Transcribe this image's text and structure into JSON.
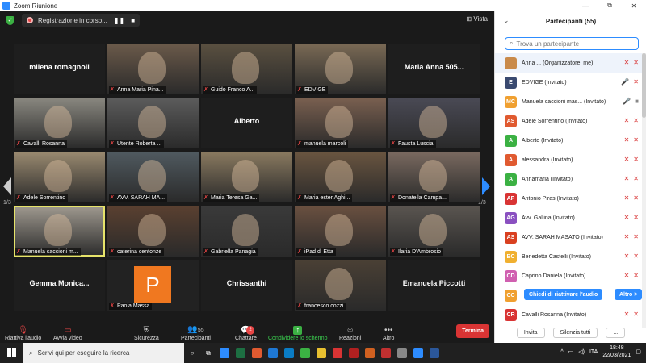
{
  "window": {
    "title": "Zoom Riunione",
    "min_glyph": "—",
    "max_glyph": "⧉",
    "close_glyph": "✕"
  },
  "topbar": {
    "recording_text": "Registrazione in corso...",
    "pause_glyph": "❚❚",
    "stop_glyph": "■",
    "view_label": "Vista",
    "view_glyph": "⊞",
    "shield_glyph": "✓"
  },
  "pages": {
    "left": "1/3",
    "right": "1/3"
  },
  "tiles": [
    {
      "name": "milena romagnoli",
      "type": "black"
    },
    {
      "name": "Anna Maria Pina...",
      "type": "video",
      "bg": "#6b5a4a"
    },
    {
      "name": "Guido Franco A...",
      "type": "video",
      "bg": "#5a5040"
    },
    {
      "name": "EDVIGE",
      "type": "video",
      "bg": "#7a6a55"
    },
    {
      "name": "Maria Anna 505...",
      "type": "black"
    },
    {
      "name": "Cavalli Rosanna",
      "type": "video",
      "bg": "#8a8880"
    },
    {
      "name": "Utente Roberta ...",
      "type": "video",
      "bg": "#5c5c5c"
    },
    {
      "name": "Alberto",
      "type": "black"
    },
    {
      "name": "manuela marcoli",
      "type": "video",
      "bg": "#7a6050"
    },
    {
      "name": "Fausta Luscia",
      "type": "video",
      "bg": "#4a4a55"
    },
    {
      "name": "Adele Sorrentino",
      "type": "video",
      "bg": "#9a8a70"
    },
    {
      "name": "AVV. SARAH MA...",
      "type": "video",
      "bg": "#505a60"
    },
    {
      "name": "Maria Teresa Ga...",
      "type": "video",
      "bg": "#8a7a60"
    },
    {
      "name": "Maria ester Aghi...",
      "type": "video",
      "bg": "#6a5540"
    },
    {
      "name": "Donatella Campa...",
      "type": "video",
      "bg": "#7a6a60"
    },
    {
      "name": "Manuela caccioni m...",
      "type": "video",
      "bg": "#a09a90",
      "active": true
    },
    {
      "name": "caterina centonze",
      "type": "video",
      "bg": "#5a4030"
    },
    {
      "name": "Gabriella Panagia",
      "type": "video",
      "bg": "#3a3a3a"
    },
    {
      "name": "iPad di Etta",
      "type": "video",
      "bg": "#6a5040"
    },
    {
      "name": "Ilaria D'Ambrosio",
      "type": "video",
      "bg": "#5a5550"
    },
    {
      "name": "Gemma  Monica...",
      "type": "black"
    },
    {
      "name": "Paola Massa",
      "type": "letter",
      "letter": "P"
    },
    {
      "name": "Chrissanthi",
      "type": "black"
    },
    {
      "name": "francesco.cozzi",
      "type": "video",
      "bg": "#4a4035"
    },
    {
      "name": "Emanuela Piccotti",
      "type": "black"
    }
  ],
  "toolbar": {
    "audio": "Riattiva l'audio",
    "video": "Avvia video",
    "security": "Sicurezza",
    "participants": "Partecipanti",
    "participants_count": "55",
    "chat": "Chattare",
    "chat_badge": "2",
    "share": "Condividere lo schermo",
    "reactions": "Reazioni",
    "more": "Altro",
    "end": "Termina"
  },
  "panel": {
    "title": "Partecipanti (55)",
    "collapse_glyph": "⌄",
    "search_placeholder": "Trova un partecipante",
    "tip_left": "Chiedi di riattivare l'audio",
    "tip_right": "Altro >",
    "invite": "Invita",
    "mute_all": "Silenzia tutti",
    "more": "...",
    "participants": [
      {
        "initials": "",
        "name": "Anna ...  (Organizzatore, me)",
        "color": "#c98a4a",
        "mic": "✕",
        "cam": "✕"
      },
      {
        "initials": "E",
        "name": "EDVIGE (Invitato)",
        "color": "#3a4a70",
        "mic": "🎤",
        "cam": "✕"
      },
      {
        "initials": "MC",
        "name": "Manuela caccioni mas... (Invitato)",
        "color": "#f0a030",
        "mic": "🎤",
        "cam": "■"
      },
      {
        "initials": "AS",
        "name": "Adele Sorrentino (Invitato)",
        "color": "#e05a30",
        "mic": "✕",
        "cam": "✕"
      },
      {
        "initials": "A",
        "name": "Alberto (Invitato)",
        "color": "#3bb143",
        "mic": "✕",
        "cam": "✕"
      },
      {
        "initials": "A",
        "name": "alessandra (Invitato)",
        "color": "#e05a30",
        "mic": "✕",
        "cam": "✕"
      },
      {
        "initials": "A",
        "name": "Annamaria (Invitato)",
        "color": "#3bb143",
        "mic": "✕",
        "cam": "✕"
      },
      {
        "initials": "AP",
        "name": "Antonio Piras (Invitato)",
        "color": "#d93434",
        "mic": "✕",
        "cam": "✕"
      },
      {
        "initials": "AG",
        "name": "Avv. Gallina (Invitato)",
        "color": "#8a50c0",
        "mic": "✕",
        "cam": "✕"
      },
      {
        "initials": "AS",
        "name": "AVV. SARAH MASATO (Invitato)",
        "color": "#d94020",
        "mic": "✕",
        "cam": "✕"
      },
      {
        "initials": "BC",
        "name": "Benedetta Castelli (Invitato)",
        "color": "#f0b030",
        "mic": "✕",
        "cam": "✕"
      },
      {
        "initials": "CD",
        "name": "Caprino Daniela (Invitato)",
        "color": "#d060b0",
        "mic": "✕",
        "cam": "✕"
      },
      {
        "initials": "CC",
        "name": "",
        "color": "#f0a030",
        "mic": "",
        "cam": ""
      },
      {
        "initials": "CR",
        "name": "Cavalli Rosanna (Invitato)",
        "color": "#d93434",
        "mic": "✕",
        "cam": "✕"
      }
    ]
  },
  "taskbar": {
    "search_placeholder": "Scrivi qui per eseguire la ricerca",
    "lang": "ITA",
    "time": "18:48",
    "date": "22/03/2021",
    "apps": [
      "#2d8cff",
      "#1d6f42",
      "#e05a30",
      "#1e78d4",
      "#0a7cc4",
      "#3bb143",
      "#e8c030",
      "#d93434",
      "#b02020",
      "#d06020",
      "#c03030",
      "#888888",
      "#2d8cff",
      "#2b579a"
    ]
  }
}
